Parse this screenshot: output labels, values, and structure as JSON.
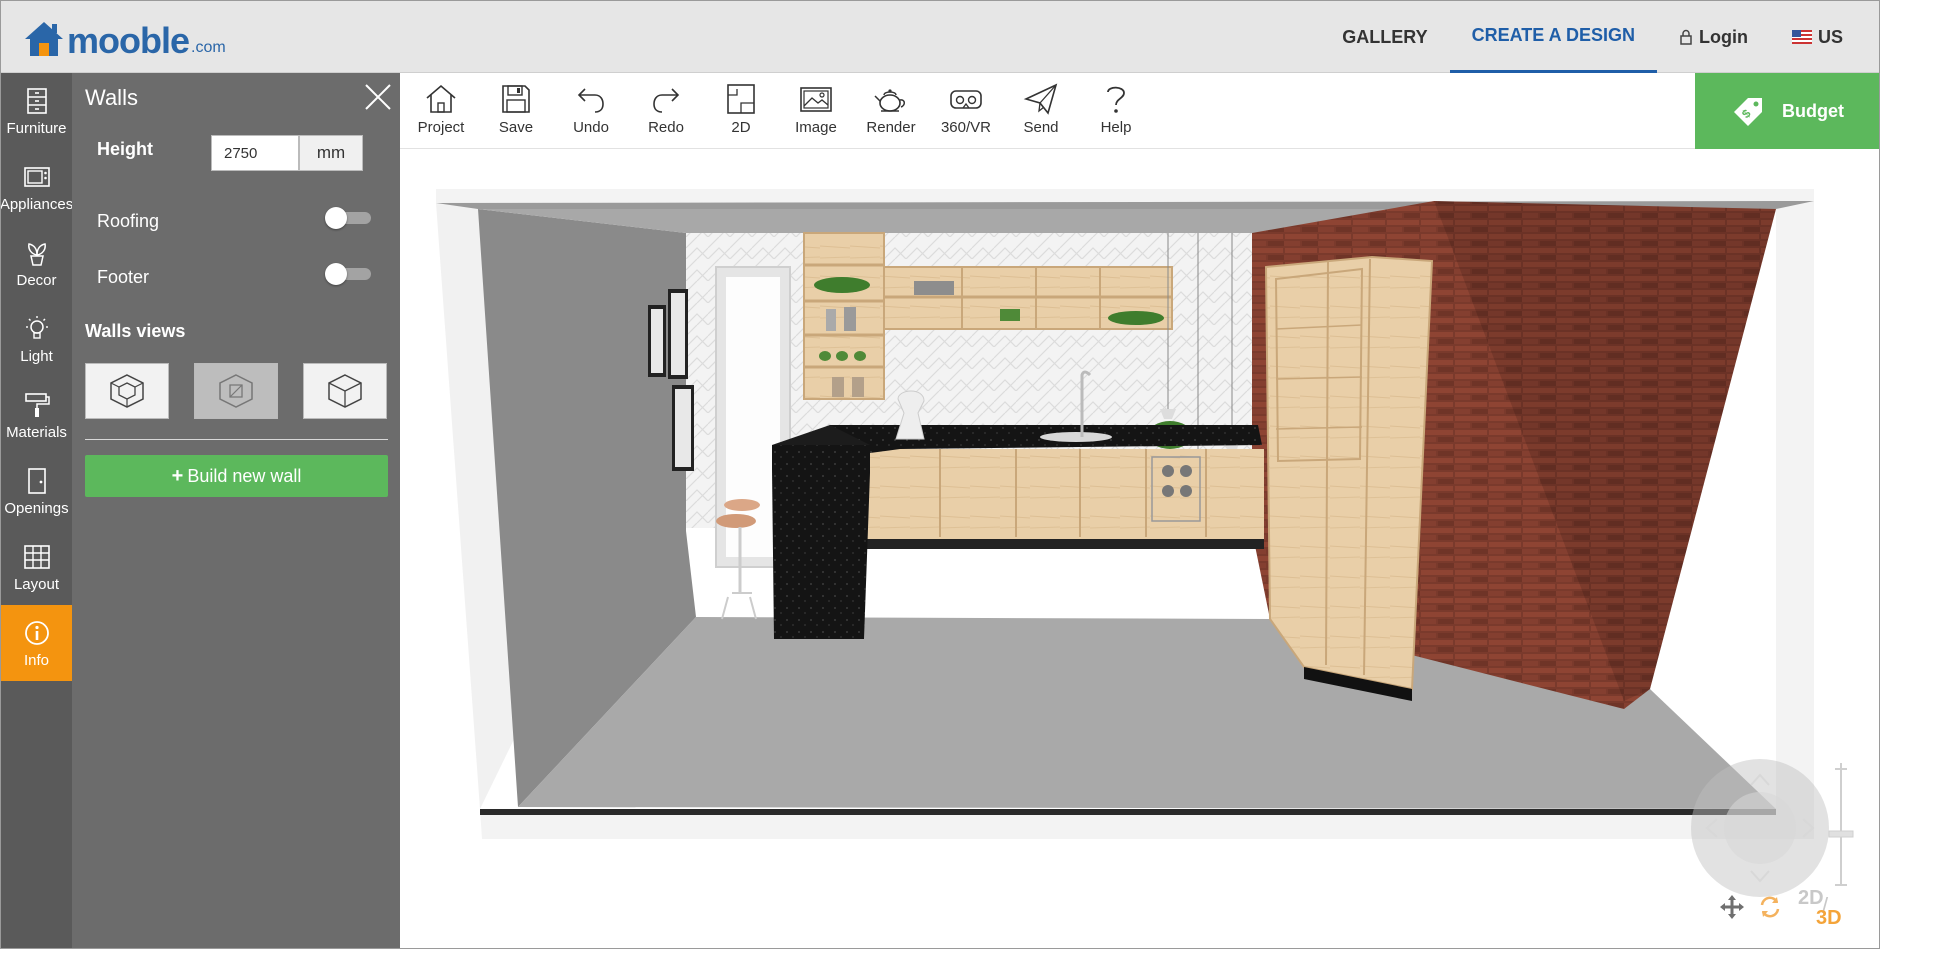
{
  "header": {
    "logo_brand": "mooble",
    "logo_tld": ".com",
    "nav": [
      {
        "label": "GALLERY"
      },
      {
        "label": "CREATE A DESIGN"
      },
      {
        "label": "Login"
      },
      {
        "label": "US"
      }
    ]
  },
  "rail": {
    "items": [
      {
        "label": "Furniture",
        "icon": "furniture-icon"
      },
      {
        "label": "Appliances",
        "icon": "microwave-icon"
      },
      {
        "label": "Decor",
        "icon": "plant-icon"
      },
      {
        "label": "Light",
        "icon": "bulb-icon"
      },
      {
        "label": "Materials",
        "icon": "paint-roller-icon"
      },
      {
        "label": "Openings",
        "icon": "door-icon"
      },
      {
        "label": "Layout",
        "icon": "grid-icon"
      },
      {
        "label": "Info",
        "icon": "info-icon"
      }
    ],
    "active_item": "Info",
    "active_color": "#f4940f"
  },
  "panel": {
    "title": "Walls",
    "height_label": "Height",
    "height_value": "2750",
    "height_unit": "mm",
    "roofing_label": "Roofing",
    "roofing_on": false,
    "footer_label": "Footer",
    "footer_on": false,
    "views_heading": "Walls views",
    "selected_view": 2,
    "build_button": "Build new wall"
  },
  "toolbar": {
    "tools": [
      {
        "label": "Project",
        "icon": "home-icon"
      },
      {
        "label": "Save",
        "icon": "floppy-icon"
      },
      {
        "label": "Undo",
        "icon": "undo-icon"
      },
      {
        "label": "Redo",
        "icon": "redo-icon"
      },
      {
        "label": "2D",
        "icon": "floorplan-icon"
      },
      {
        "label": "Image",
        "icon": "image-icon"
      },
      {
        "label": "Render",
        "icon": "teapot-icon"
      },
      {
        "label": "360/VR",
        "icon": "vr-headset-icon"
      },
      {
        "label": "Send",
        "icon": "paper-plane-icon"
      },
      {
        "label": "Help",
        "icon": "question-icon"
      }
    ],
    "budget_label": "Budget"
  },
  "view_toggle": {
    "label_2d": "2D",
    "label_3d": "3D",
    "active": "3D"
  },
  "colors": {
    "brand_blue": "#2a66a8",
    "accent_green": "#5cb85c",
    "rail_bg": "#5a5a5a",
    "panel_bg": "#6c6c6c"
  }
}
